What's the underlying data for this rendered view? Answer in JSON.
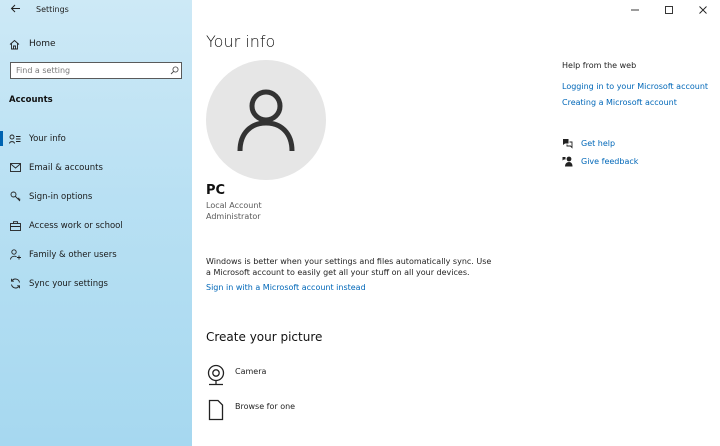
{
  "window": {
    "title": "Settings"
  },
  "sidebar": {
    "home_label": "Home",
    "search_placeholder": "Find a setting",
    "section_heading": "Accounts",
    "items": [
      {
        "label": "Your info",
        "icon": "person-list-icon",
        "active": true
      },
      {
        "label": "Email & accounts",
        "icon": "mail-icon",
        "active": false
      },
      {
        "label": "Sign-in options",
        "icon": "key-icon",
        "active": false
      },
      {
        "label": "Access work or school",
        "icon": "briefcase-icon",
        "active": false
      },
      {
        "label": "Family & other users",
        "icon": "add-person-icon",
        "active": false
      },
      {
        "label": "Sync your settings",
        "icon": "sync-icon",
        "active": false
      }
    ]
  },
  "main": {
    "title": "Your info",
    "user": {
      "name": "PC",
      "account_type": "Local Account",
      "role": "Administrator"
    },
    "sync_message": "Windows is better when your settings and files automatically sync. Use a Microsoft account to easily get all your stuff on all your devices.",
    "ms_signin_link": "Sign in with a Microsoft account instead",
    "picture_heading": "Create your picture",
    "picture_options": [
      {
        "label": "Camera",
        "icon": "camera-icon"
      },
      {
        "label": "Browse for one",
        "icon": "file-icon"
      }
    ]
  },
  "help": {
    "heading": "Help from the web",
    "links": [
      "Logging in to your Microsoft account",
      "Creating a Microsoft account"
    ],
    "actions": [
      {
        "label": "Get help",
        "icon": "get-help-icon"
      },
      {
        "label": "Give feedback",
        "icon": "feedback-icon"
      }
    ]
  },
  "colors": {
    "accent": "#0063b1",
    "link": "#0067b8",
    "sidebar": "#b8e0f3",
    "avatar_bg": "#e6e6e6"
  }
}
